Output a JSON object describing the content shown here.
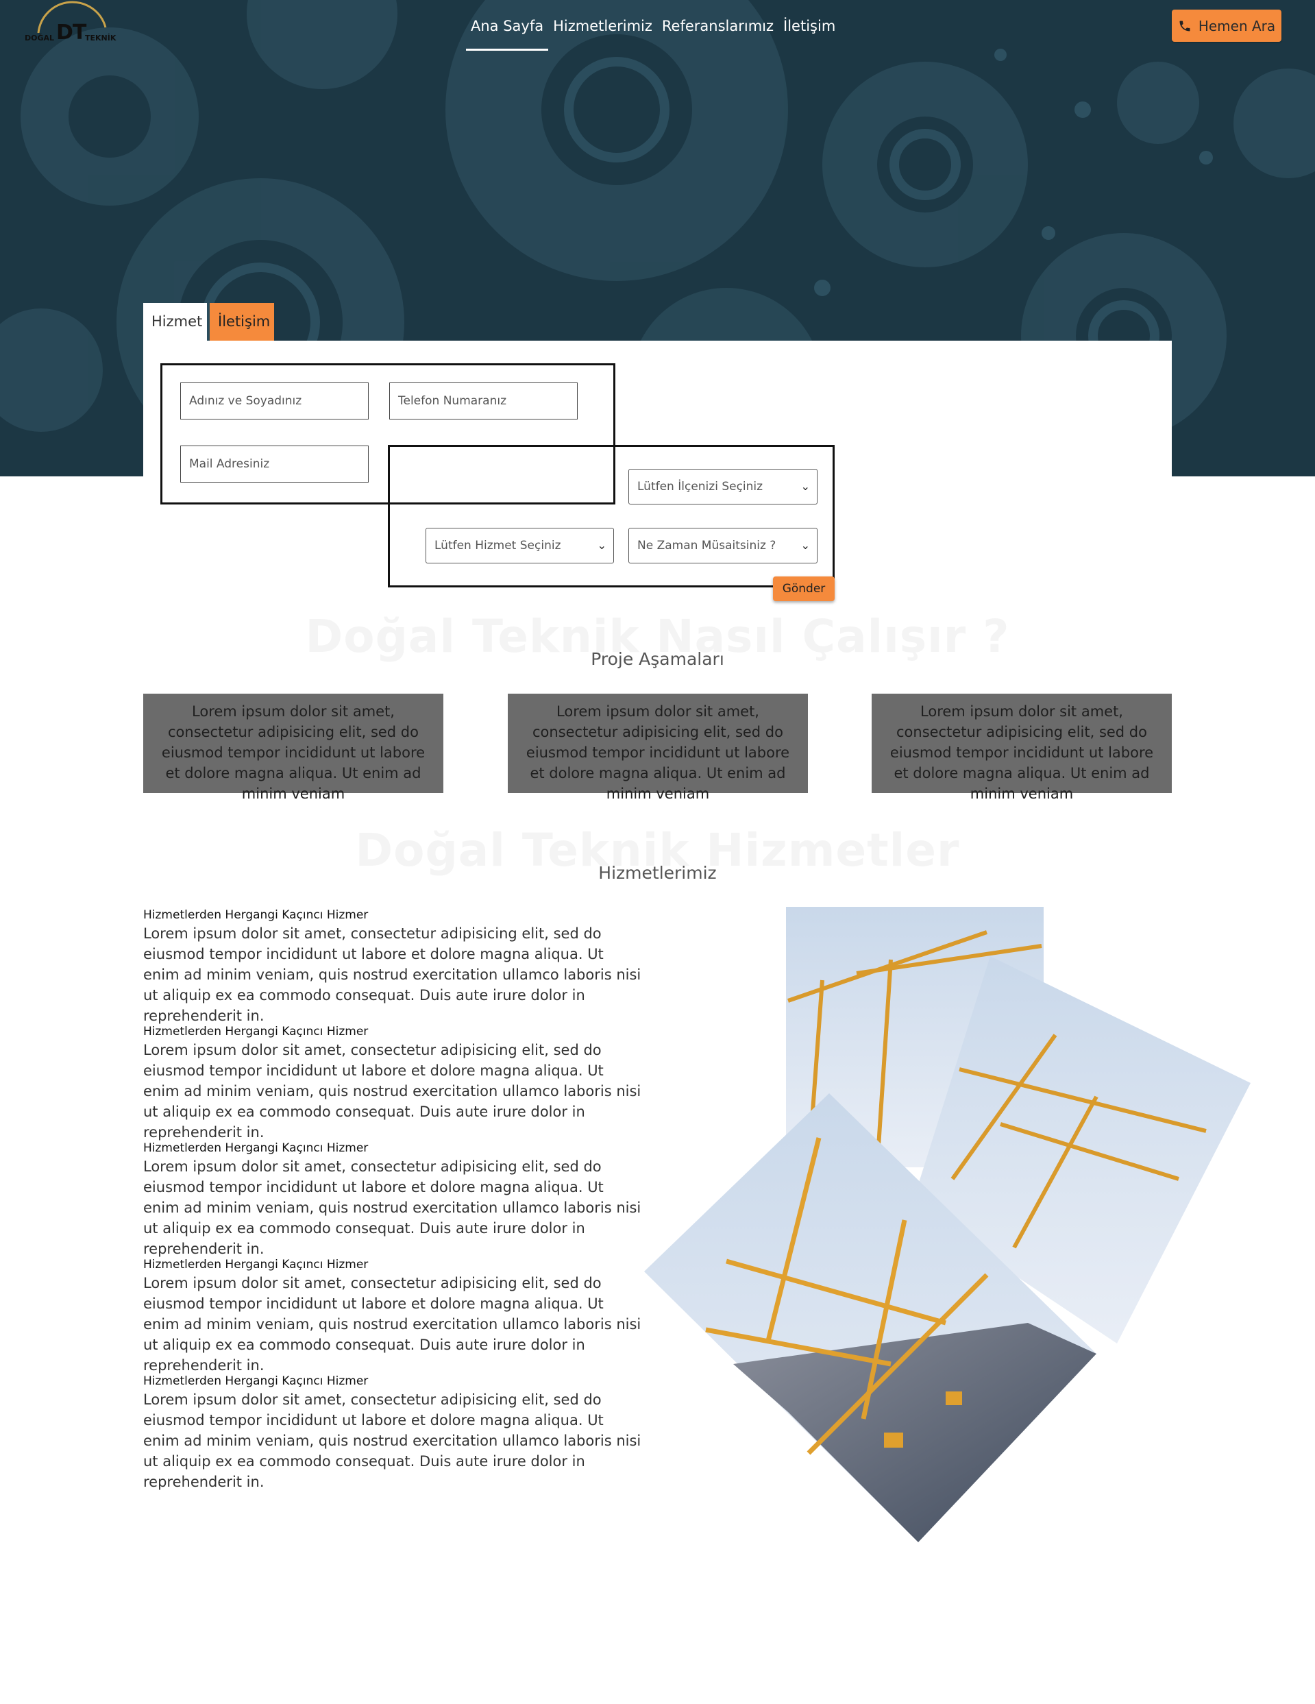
{
  "brand": {
    "left": "DOĞAL",
    "mark": "DT",
    "right": "TEKNİK"
  },
  "nav": {
    "items": [
      {
        "label": "Ana Sayfa",
        "active": true
      },
      {
        "label": "Hizmetlerimiz",
        "active": false
      },
      {
        "label": "Referanslarımız",
        "active": false
      },
      {
        "label": "İletişim",
        "active": false
      }
    ]
  },
  "call_button": {
    "label": "Hemen Ara",
    "icon": "phone-icon"
  },
  "tabs": [
    {
      "label": "Hizmet"
    },
    {
      "label": "İletişim"
    }
  ],
  "form": {
    "name_placeholder": "Adınız ve Soyadınız",
    "phone_placeholder": "Telefon Numaranız",
    "mail_placeholder": "Mail Adresiniz",
    "district_select": "Lütfen İlçenizi Seçiniz",
    "service_select": "Lütfen Hizmet Seçiniz",
    "availability_select": "Ne Zaman Müsaitsiniz ?",
    "submit": "Gönder"
  },
  "how_it_works": {
    "ghost_title": "Doğal Teknik Nasıl Çalışır ?",
    "subtitle": "Proje Aşamaları",
    "cards": [
      {
        "text": "Lorem ipsum dolor sit amet, consectetur adipisicing elit, sed do eiusmod tempor incididunt ut labore et dolore magna aliqua. Ut enim ad minim veniam"
      },
      {
        "text": "Lorem ipsum dolor sit amet, consectetur adipisicing elit, sed do eiusmod tempor incididunt ut labore et dolore magna aliqua. Ut enim ad minim veniam"
      },
      {
        "text": "Lorem ipsum dolor sit amet, consectetur adipisicing elit, sed do eiusmod tempor incididunt ut labore et dolore magna aliqua. Ut enim ad minim veniam"
      }
    ]
  },
  "services": {
    "ghost_title": "Doğal Teknik Hizmetler",
    "subtitle": "Hizmetlerimiz",
    "items": [
      {
        "title": "Hizmetlerden Hergangi Kaçıncı Hizmer",
        "text": "Lorem ipsum dolor sit amet, consectetur adipisicing elit, sed do eiusmod tempor incididunt ut labore et dolore magna aliqua. Ut enim ad minim veniam, quis nostrud exercitation ullamco laboris nisi ut aliquip ex ea commodo consequat. Duis aute irure dolor in reprehenderit in."
      },
      {
        "title": "Hizmetlerden Hergangi Kaçıncı Hizmer",
        "text": "Lorem ipsum dolor sit amet, consectetur adipisicing elit, sed do eiusmod tempor incididunt ut labore et dolore magna aliqua. Ut enim ad minim veniam, quis nostrud exercitation ullamco laboris nisi ut aliquip ex ea commodo consequat. Duis aute irure dolor in reprehenderit in."
      },
      {
        "title": "Hizmetlerden Hergangi Kaçıncı Hizmer",
        "text": "Lorem ipsum dolor sit amet, consectetur adipisicing elit, sed do eiusmod tempor incididunt ut labore et dolore magna aliqua. Ut enim ad minim veniam, quis nostrud exercitation ullamco laboris nisi ut aliquip ex ea commodo consequat. Duis aute irure dolor in reprehenderit in."
      },
      {
        "title": "Hizmetlerden Hergangi Kaçıncı Hizmer",
        "text": "Lorem ipsum dolor sit amet, consectetur adipisicing elit, sed do eiusmod tempor incididunt ut labore et dolore magna aliqua. Ut enim ad minim veniam, quis nostrud exercitation ullamco laboris nisi ut aliquip ex ea commodo consequat. Duis aute irure dolor in reprehenderit in."
      },
      {
        "title": "Hizmetlerden Hergangi Kaçıncı Hizmer",
        "text": "Lorem ipsum dolor sit amet, consectetur adipisicing elit, sed do eiusmod tempor incididunt ut labore et dolore magna aliqua. Ut enim ad minim veniam, quis nostrud exercitation ullamco laboris nisi ut aliquip ex ea commodo consequat. Duis aute irure dolor in reprehenderit in."
      }
    ]
  },
  "colors": {
    "hero": "#1c3744",
    "accent": "#f58a3c",
    "card": "#6b6b6b"
  }
}
